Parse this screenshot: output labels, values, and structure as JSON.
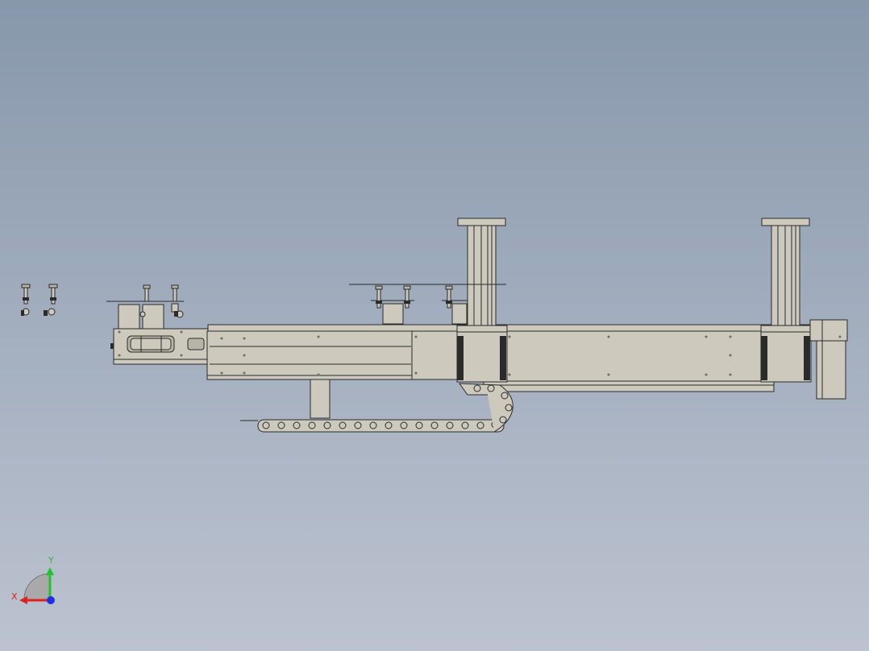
{
  "viewport": {
    "background_top": "#8798ab",
    "background_bottom": "#bcc3d0",
    "part_color": "#cdcabd",
    "edge_color": "#2a2a2a"
  },
  "triad": {
    "x_label": "X",
    "y_label": "Y",
    "x_color": "#e0201c",
    "y_color": "#21c42a",
    "z_color": "#2030e0"
  }
}
